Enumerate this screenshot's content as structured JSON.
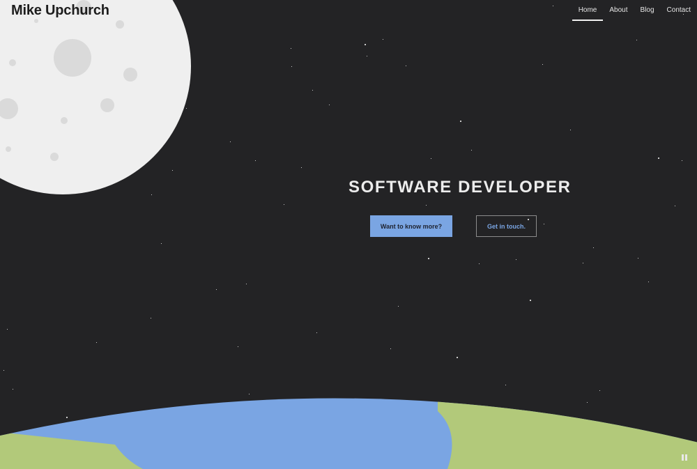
{
  "site": {
    "title": "Mike Upchurch"
  },
  "nav": {
    "items": [
      {
        "label": "Home",
        "active": true
      },
      {
        "label": "About",
        "active": false
      },
      {
        "label": "Blog",
        "active": false
      },
      {
        "label": "Contact",
        "active": false
      }
    ]
  },
  "hero": {
    "title": "SOFTWARE DEVELOPER",
    "primary_button": "Want to know more?",
    "secondary_button": "Get in touch."
  },
  "colors": {
    "background": "#232325",
    "moon": "#efefef",
    "moon_craters": "#dadada",
    "ocean": "#7aa5e3",
    "land": "#b2c97a",
    "accent": "#7aa5e3"
  },
  "icons": {
    "pause": "pause-icon"
  }
}
